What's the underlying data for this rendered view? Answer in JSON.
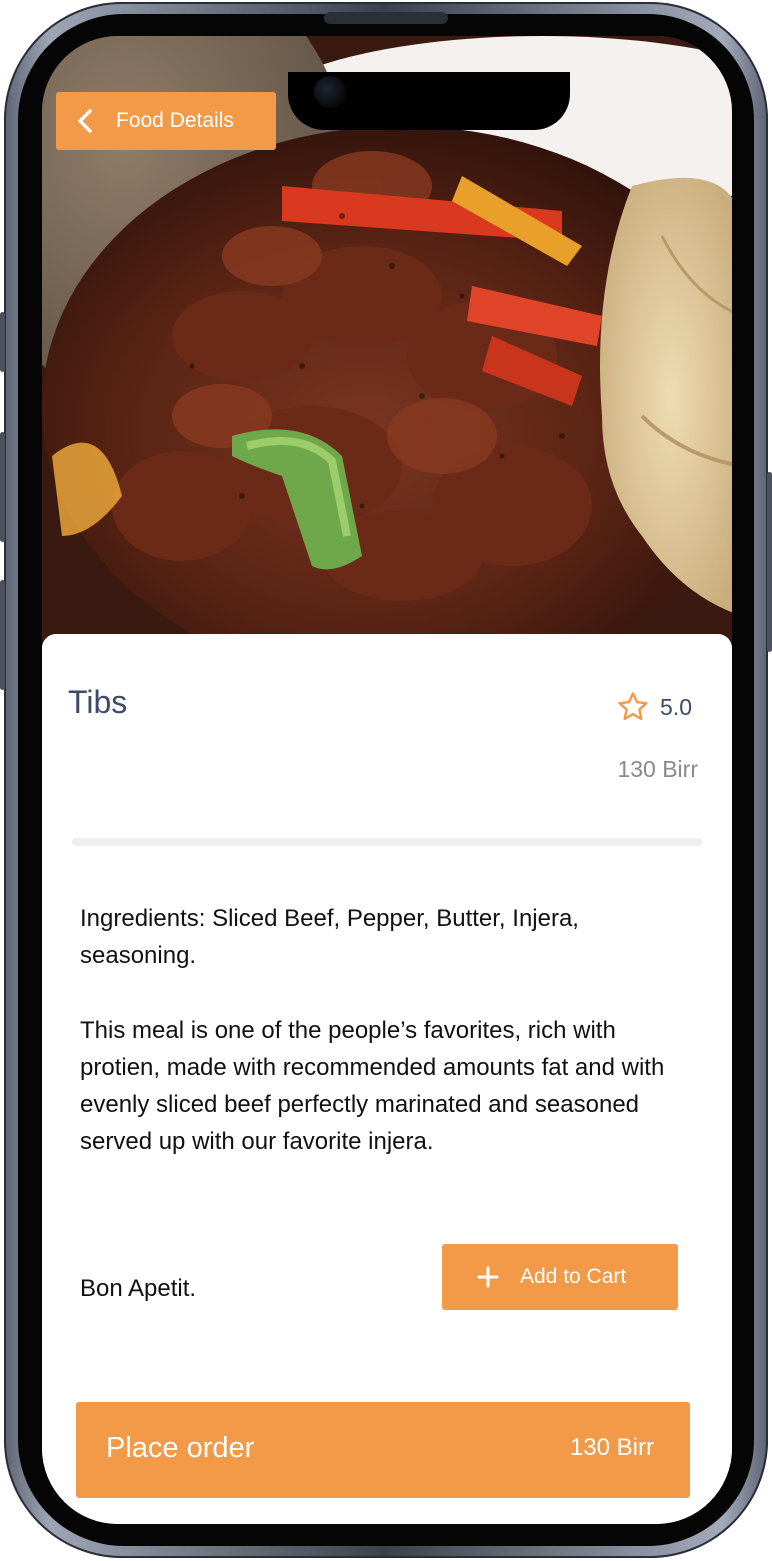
{
  "header": {
    "back_label": "Food Details"
  },
  "food": {
    "name": "Tibs",
    "rating": "5.0",
    "price": "130 Birr",
    "ingredients": "Ingredients: Sliced Beef, Pepper, Butter, Injera, seasoning.",
    "description": "This meal is one of the people’s favorites, rich with protien, made with recommended amounts fat and with evenly sliced beef perfectly marinated and seasoned served up with our favorite injera.",
    "sign_off": "Bon Apetit."
  },
  "actions": {
    "add_to_cart_label": "Add to Cart",
    "add_to_cart_icon": "plus-icon",
    "place_order_label": "Place order",
    "place_order_price": "130 Birr"
  },
  "icons": {
    "back": "chevron-left-icon",
    "rating": "star-outline-icon"
  },
  "colors": {
    "accent": "#f39a48",
    "title_text": "#3f4a6b",
    "muted_text": "#8a8a8a",
    "divider": "#efefef"
  }
}
